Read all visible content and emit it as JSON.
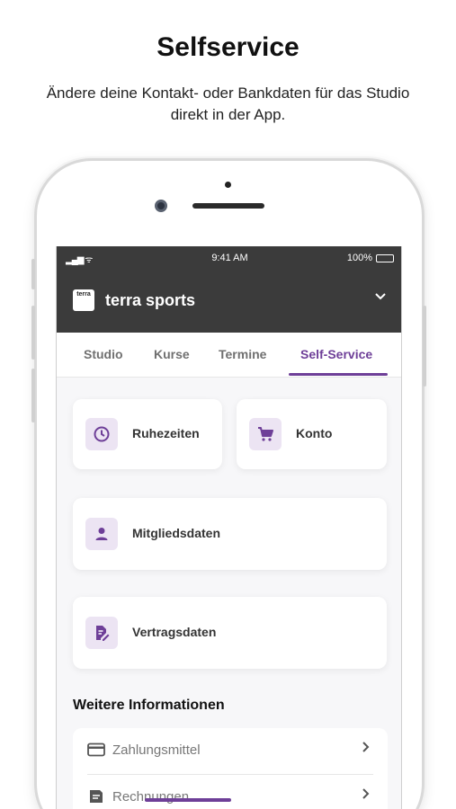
{
  "promo": {
    "title": "Selfservice",
    "subtitle": "Ändere deine Kontakt- oder Bankdaten für das Studio direkt in der App."
  },
  "status_bar": {
    "signal": "▂▄▆ ᯤ",
    "time": "9:41 AM",
    "battery": "100%"
  },
  "app": {
    "logo_text": "terra",
    "name": "terra sports",
    "chevron": "⌄"
  },
  "tabs": [
    {
      "label": "Studio",
      "active": false
    },
    {
      "label": "Kurse",
      "active": false
    },
    {
      "label": "Termine",
      "active": false
    },
    {
      "label": "Self-Service",
      "active": true
    }
  ],
  "cards": [
    {
      "label": "Ruhezeiten",
      "icon": "clock-icon"
    },
    {
      "label": "Konto",
      "icon": "cart-icon"
    },
    {
      "label": "Mitgliedsdaten",
      "icon": "person-icon"
    },
    {
      "label": "Vertragsdaten",
      "icon": "document-edit-icon"
    }
  ],
  "more_info": {
    "title": "Weitere Informationen",
    "items": [
      {
        "label": "Zahlungsmittel",
        "icon": "credit-card-icon"
      },
      {
        "label": "Rechnungen",
        "icon": "receipt-icon"
      }
    ]
  },
  "colors": {
    "accent": "#6e3f98",
    "header": "#3b3b3b",
    "icon_bg": "#ece4f3"
  }
}
